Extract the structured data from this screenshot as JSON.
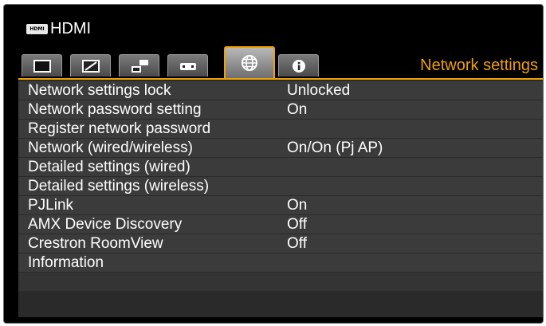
{
  "header": {
    "badge": "HDMI",
    "source": "HDMI"
  },
  "tabs": [
    {
      "icon": "image-adjust-icon"
    },
    {
      "icon": "install-settings-icon"
    },
    {
      "icon": "system-settings-icon"
    },
    {
      "icon": "remote-control-icon"
    },
    {
      "icon": "network-globe-icon",
      "active": true
    },
    {
      "icon": "information-icon"
    }
  ],
  "active_tab_label": "Network settings",
  "menu": [
    {
      "label": "Network settings lock",
      "value": "Unlocked"
    },
    {
      "label": "Network password setting",
      "value": "On"
    },
    {
      "label": "Register network password",
      "value": ""
    },
    {
      "label": "Network (wired/wireless)",
      "value": "On/On (Pj AP)"
    },
    {
      "label": "Detailed settings (wired)",
      "value": ""
    },
    {
      "label": "Detailed settings (wireless)",
      "value": ""
    },
    {
      "label": "PJLink",
      "value": "On"
    },
    {
      "label": "AMX Device Discovery",
      "value": "Off"
    },
    {
      "label": "Crestron RoomView",
      "value": "Off"
    },
    {
      "label": "Information",
      "value": ""
    }
  ],
  "colors": {
    "accent": "#f0a000",
    "background": "#000000",
    "row": "#3b3b3b"
  }
}
